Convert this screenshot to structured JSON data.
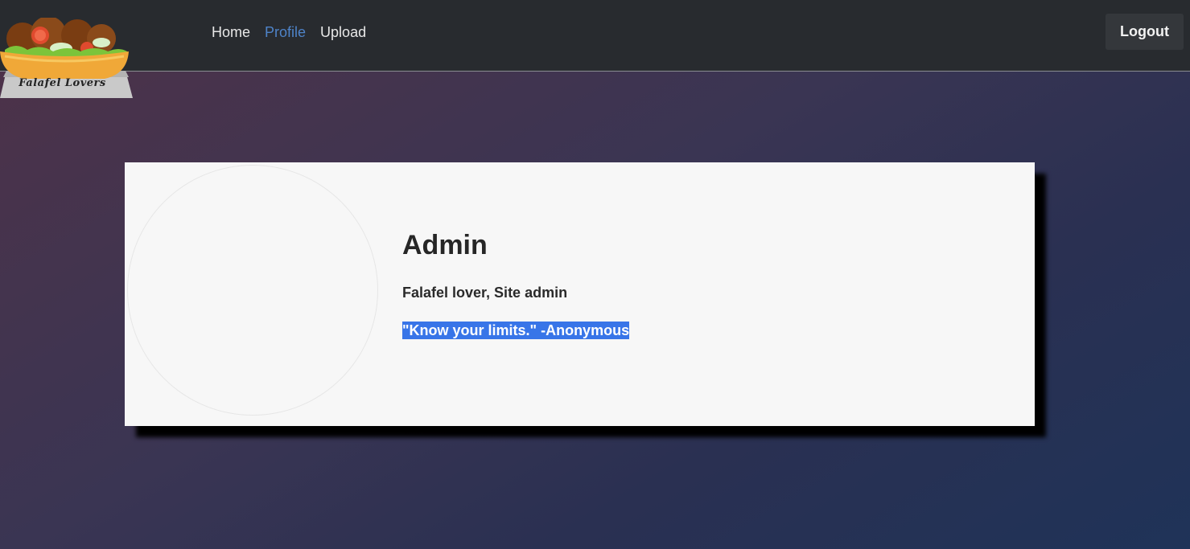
{
  "logo": {
    "text": "Falafel Lovers"
  },
  "nav": {
    "links": [
      {
        "label": "Home",
        "active": false
      },
      {
        "label": "Profile",
        "active": true
      },
      {
        "label": "Upload",
        "active": false
      }
    ],
    "logout_label": "Logout"
  },
  "profile": {
    "name": "Admin",
    "title": "Falafel lover, Site admin",
    "quote": "\"Know your limits.\" -Anonymous"
  },
  "colors": {
    "navbar_bg": "#282b2f",
    "active_link": "#4e83c8",
    "selection": "#3875e8",
    "card_bg": "#f7f7f7"
  }
}
